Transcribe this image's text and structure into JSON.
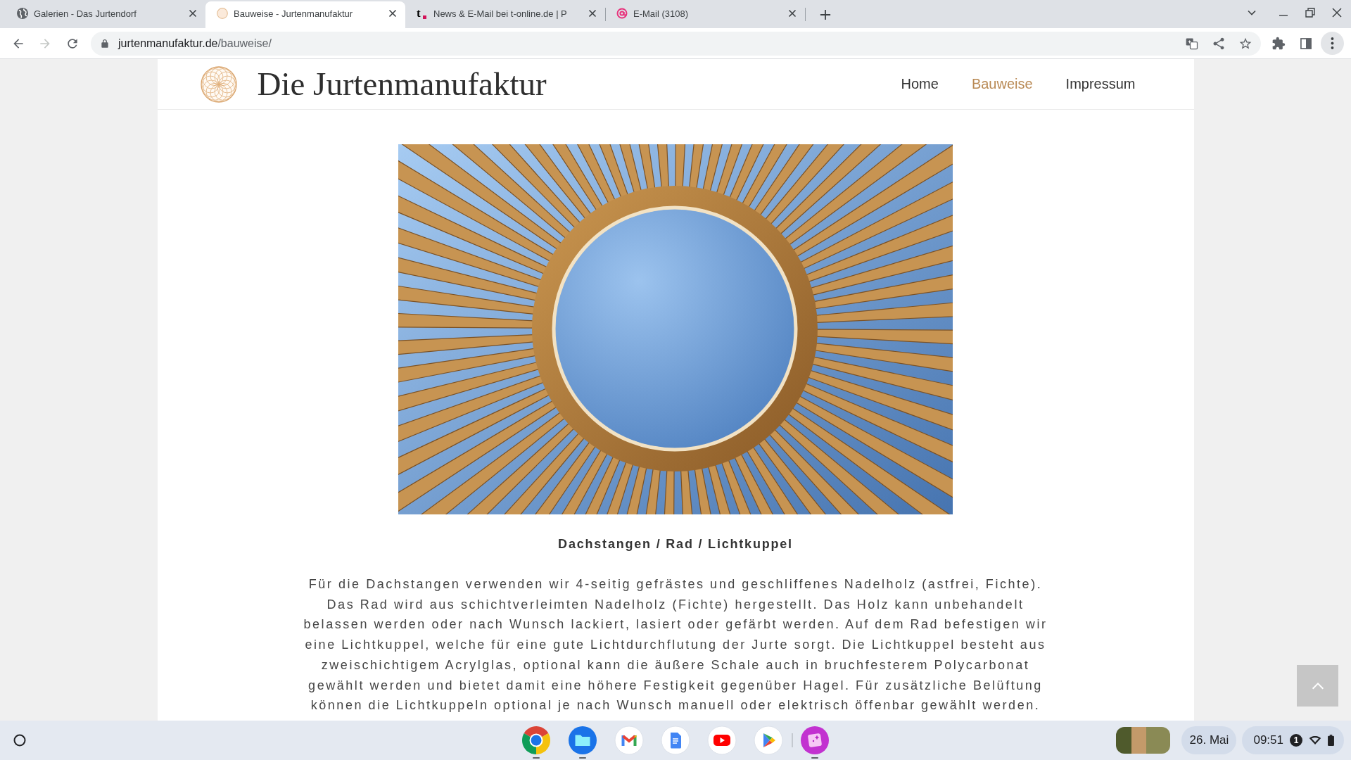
{
  "browser": {
    "tabs": [
      {
        "title": "Galerien - Das Jurtendorf",
        "selected": false
      },
      {
        "title": "Bauweise - Jurtenmanufaktur",
        "selected": true
      },
      {
        "title": "News & E-Mail bei t-online.de | P",
        "favicon_text": "t",
        "selected": false
      },
      {
        "title": "E-Mail (3108)",
        "selected": false
      }
    ],
    "forward_disabled": true,
    "address": {
      "domain": "jurtenmanufaktur.de",
      "path": "/bauweise/"
    }
  },
  "site": {
    "title": "Die Jurtenmanufaktur",
    "nav": [
      {
        "label": "Home",
        "selected": false
      },
      {
        "label": "Bauweise",
        "selected": true
      },
      {
        "label": "Impressum",
        "selected": false
      }
    ]
  },
  "content": {
    "caption": "Dachstangen / Rad / Lichtkuppel",
    "text": "Für die Dachstangen verwenden wir 4-seitig gefrästes und geschliffenes Nadelholz (astfrei, Fichte). Das Rad wird aus schichtverleimten Nadelholz (Fichte) hergestellt. Das Holz kann unbehandelt belassen werden oder nach Wunsch lackiert, lasiert oder gefärbt werden. Auf dem Rad befestigen wir eine Lichtkuppel, welche für eine gute Lichtdurchflutung der Jurte sorgt. Die Lichtkuppel besteht aus zweischichtigem Acrylglas, optional kann die äußere Schale auch in bruchfesterem Polycarbonat gewählt werden und bietet damit eine höhere Festigkeit gegenüber Hagel. Für zusätzliche Belüftung können die Lichtkuppeln optional je nach Wunsch manuell oder elektrisch öffenbar gewählt werden."
  },
  "taskbar": {
    "apps": [
      {
        "running": true
      },
      {
        "running": true
      },
      {
        "running": false
      },
      {
        "running": false
      },
      {
        "running": false
      },
      {
        "running": false
      },
      {
        "running": true
      }
    ],
    "date": "26. Mai",
    "time": "09:51",
    "notifications": "1"
  }
}
